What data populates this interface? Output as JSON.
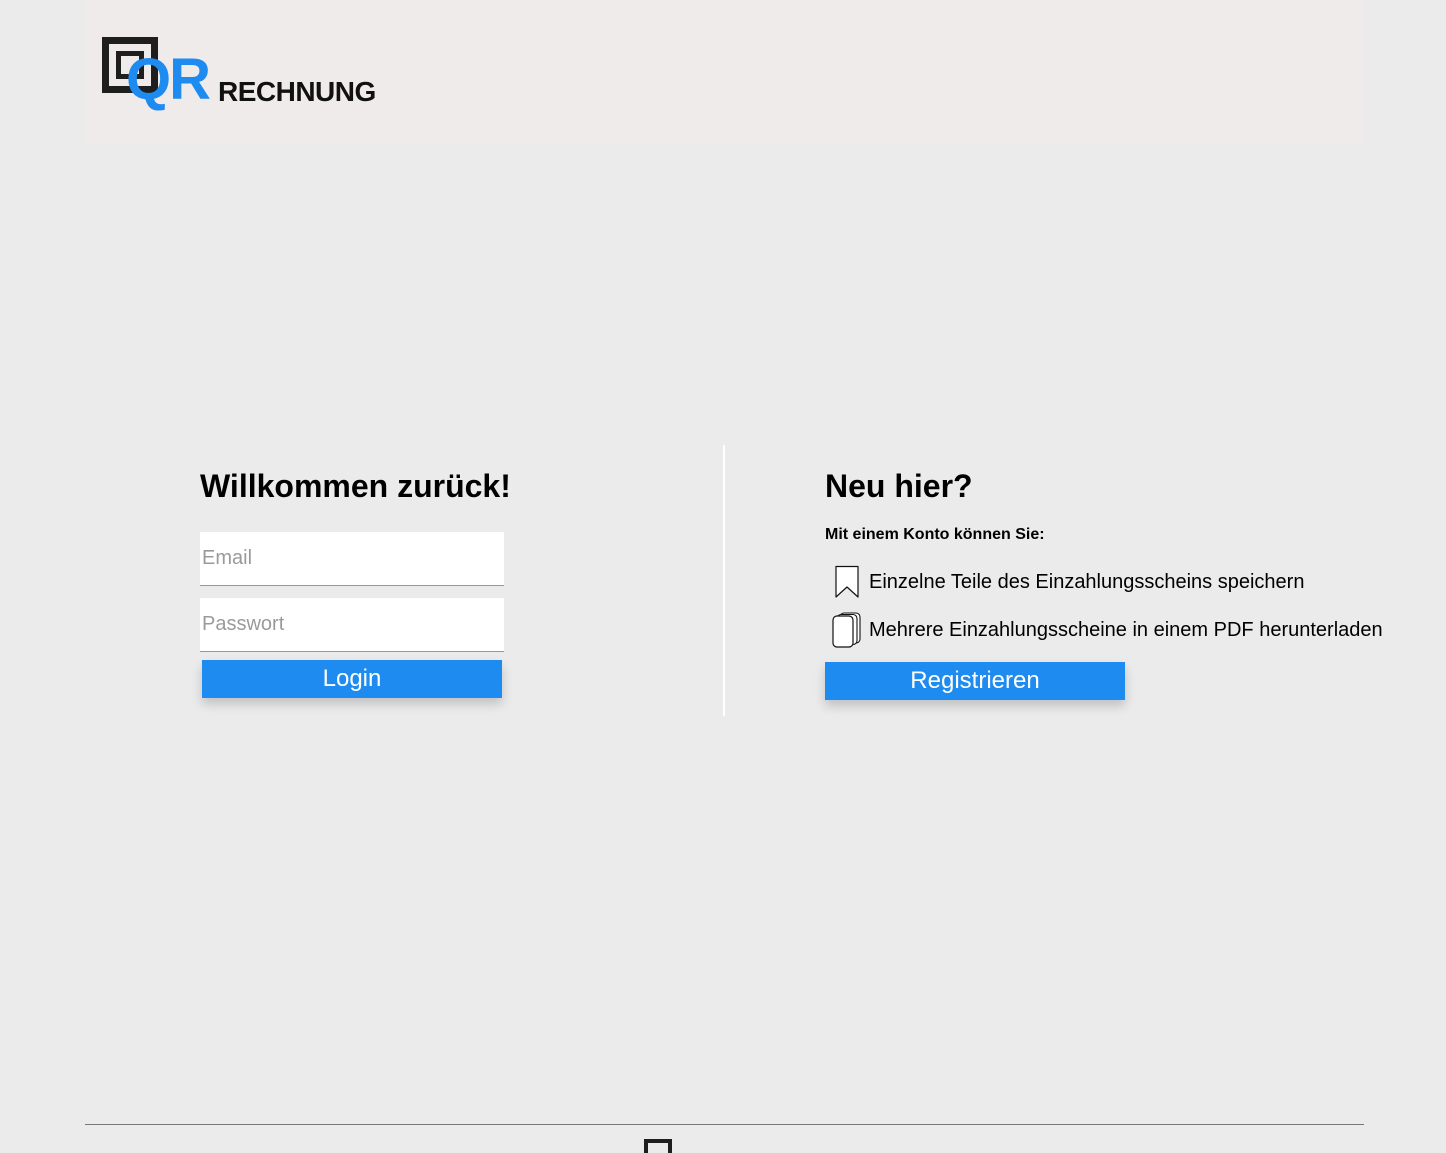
{
  "brand": {
    "logo_qr": "QR",
    "logo_rechnung": "RECHNUNG",
    "accent_color": "#1e8bf0"
  },
  "login": {
    "title": "Willkommen zurück!",
    "email_placeholder": "Email",
    "password_placeholder": "Passwort",
    "button_label": "Login"
  },
  "register": {
    "title": "Neu hier?",
    "subtitle": "Mit einem Konto können Sie:",
    "benefits": [
      {
        "icon": "bookmark-icon",
        "text": "Einzelne Teile des Einzahlungsscheins speichern"
      },
      {
        "icon": "documents-stack-icon",
        "text": "Mehrere Einzahlungsscheine in einem PDF herunterladen"
      }
    ],
    "button_label": "Registrieren"
  }
}
